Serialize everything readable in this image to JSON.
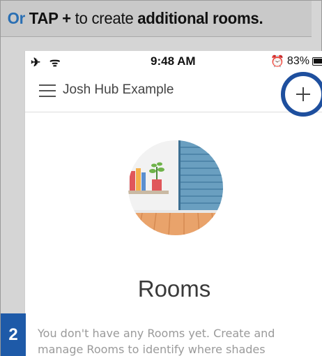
{
  "instruction": {
    "or": "Or",
    "tap": "TAP +",
    "middle": "to create",
    "target": "additional rooms."
  },
  "status_bar": {
    "left_icons": "✈ ᯤ",
    "time": "9:48 AM",
    "battery": "83%"
  },
  "nav": {
    "title": "Josh Hub Example",
    "add_symbol": "+"
  },
  "main": {
    "title": "Rooms",
    "empty_line1": "You don't have any Rooms yet. Create and",
    "empty_line2": "manage Rooms to identify where shades"
  },
  "step": "2",
  "colors": {
    "highlight_ring": "#1e4f9e",
    "step_badge": "#1e5aa8",
    "or_text": "#2a6fb3"
  }
}
